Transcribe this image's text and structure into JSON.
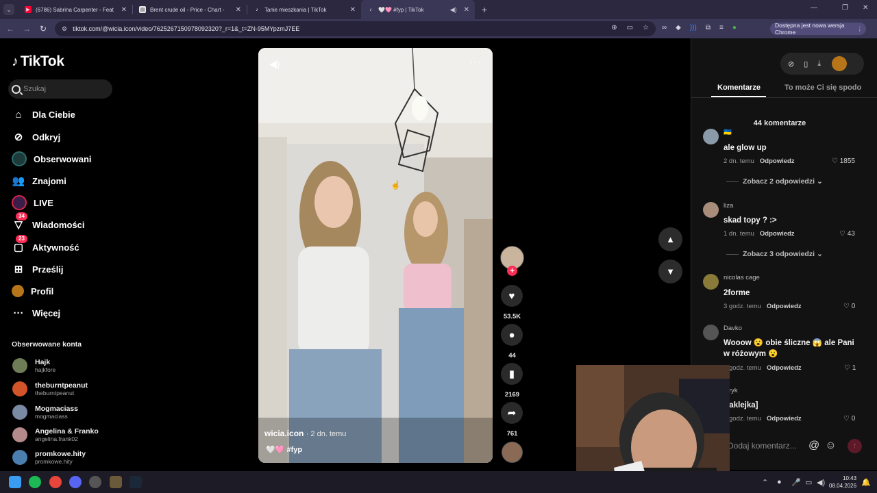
{
  "browser": {
    "tabs": [
      {
        "title": "(6786) Sabrina Carpenter - Feat",
        "favicon": "youtube-icon",
        "active": false
      },
      {
        "title": "Brent crude oil - Price - Chart -",
        "favicon": "page-icon",
        "active": false
      },
      {
        "title": "Tanie mieszkania | TikTok",
        "favicon": "tiktok-icon",
        "active": false
      },
      {
        "title": "🤍🩷 #fyp | TikTok",
        "favicon": "tiktok-icon",
        "active": true
      }
    ],
    "url": "tiktok.com/@wicia.icon/video/7625267150978092320?_r=1&_t=ZN-95MYpzmJ7EE",
    "update_text": "Dostępna jest nowa wersja Chrome"
  },
  "tiktok": {
    "logo": "TikTok",
    "search_placeholder": "Szukaj",
    "nav": [
      {
        "label": "Dla Ciebie",
        "icon": "home-icon"
      },
      {
        "label": "Odkryj",
        "icon": "compass-icon"
      },
      {
        "label": "Obserwowani",
        "icon": "avatar-icon"
      },
      {
        "label": "Znajomi",
        "icon": "friends-icon"
      },
      {
        "label": "LIVE",
        "icon": "live-icon"
      },
      {
        "label": "Wiadomości",
        "icon": "message-icon",
        "badge": "34"
      },
      {
        "label": "Aktywność",
        "icon": "activity-icon",
        "badge": "23"
      },
      {
        "label": "Prześlij",
        "icon": "upload-icon"
      },
      {
        "label": "Profil",
        "icon": "profile-icon"
      },
      {
        "label": "Więcej",
        "icon": "more-icon"
      }
    ],
    "followed_title": "Obserwowane konta",
    "followed": [
      {
        "name": "Hajk",
        "handle": "hajkfore",
        "color": "#6f7d56"
      },
      {
        "name": "theburntpeanut",
        "handle": "theburntpeanut",
        "color": "#d4542a"
      },
      {
        "name": "Mogmaciass",
        "handle": "mogmaciass",
        "color": "#7a8aa5"
      },
      {
        "name": "Angelina & Franko",
        "handle": "angelina.frank02",
        "color": "#b58a8a"
      },
      {
        "name": "promkowe.hity",
        "handle": "promkowe.hity",
        "color": "#4a7fb0"
      }
    ]
  },
  "video": {
    "author": "wicia.icon",
    "time": "· 2 dn. temu",
    "tags": "🤍🩷 #fyp",
    "likes": "53.5K",
    "comments": "44",
    "saves": "2169",
    "shares": "761"
  },
  "panel": {
    "tab_comments": "Komentarze",
    "tab_related": "To może Ci się spodo",
    "count": "44 komentarze",
    "input_placeholder": "Dodaj komentarz...",
    "comments": [
      {
        "user": "🇺🇦",
        "text": "ale glow up",
        "time": "2 dn. temu",
        "reply": "Odpowiedz",
        "likes": "1855",
        "more": "Zobacz 2 odpowiedzi",
        "color": "#8a9aa8"
      },
      {
        "user": "liza",
        "text": "skad topy ? :>",
        "time": "1 dn. temu",
        "reply": "Odpowiedz",
        "likes": "43",
        "more": "Zobacz 3 odpowiedzi",
        "color": "#a88d7a"
      },
      {
        "user": "nicolas cage",
        "text": "2forme",
        "time": "3 godz. temu",
        "reply": "Odpowiedz",
        "likes": "0",
        "color": "#8a7a3a"
      },
      {
        "user": "Davko",
        "text": "Wooow 😮 obie śliczne 😱 ale Pani w różowym 😮",
        "time": "godz. temu",
        "reply": "Odpowiedz",
        "likes": "1",
        "color": "#555555"
      },
      {
        "user": "atryk",
        "text": "Naklejka]",
        "time": "godz. temu",
        "reply": "Odpowiedz",
        "likes": "0",
        "color": "#444444"
      }
    ]
  },
  "taskbar": {
    "time": "10:43",
    "date": "08.04.2026"
  }
}
